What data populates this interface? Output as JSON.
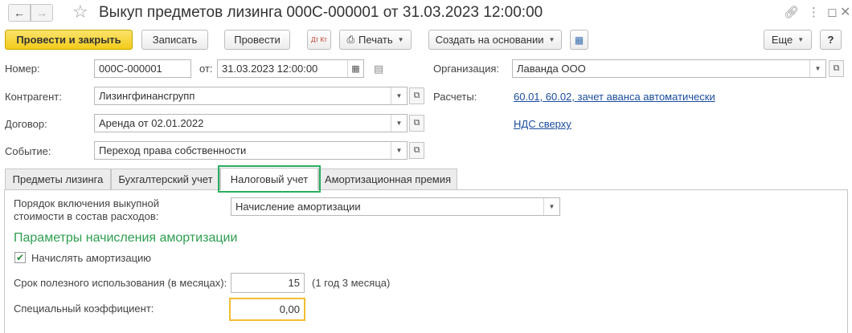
{
  "window": {
    "title": "Выкуп предметов лизинга 000С-000001 от 31.03.2023 12:00:00",
    "nav_back": "←",
    "nav_forward": "→",
    "star_icon": "☆"
  },
  "toolbar": {
    "post_close": "Провести и закрыть",
    "save": "Записать",
    "post": "Провести",
    "dt_kt": "Дт Кт",
    "print": "Печать",
    "create_based": "Создать на основании",
    "more": "Еще",
    "help": "?"
  },
  "form": {
    "number_label": "Номер:",
    "number_value": "000С-000001",
    "from_label": "от:",
    "date_value": "31.03.2023 12:00:00",
    "org_label": "Организация:",
    "org_value": "Лаванда ООО",
    "counterparty_label": "Контрагент:",
    "counterparty_value": "Лизингфинансгрупп",
    "settlements_label": "Расчеты:",
    "settlements_link": "60.01, 60.02, зачет аванса автоматически",
    "contract_label": "Договор:",
    "contract_value": "Аренда от 02.01.2022",
    "vat_link": "НДС сверху",
    "event_label": "Событие:",
    "event_value": "Переход права собственности"
  },
  "tabs": [
    {
      "label": "Предметы лизинга"
    },
    {
      "label": "Бухгалтерский учет"
    },
    {
      "label": "Налоговый учет"
    },
    {
      "label": "Амортизационная премия"
    }
  ],
  "tax": {
    "order_label_1": "Порядок включения выкупной",
    "order_label_2": "стоимости в состав расходов:",
    "order_value": "Начисление амортизации",
    "section_title": "Параметры начисления амортизации",
    "accrue_label": "Начислять амортизацию",
    "accrue_checked": true,
    "useful_life_label": "Срок полезного использования (в месяцах):",
    "useful_life_value": "15",
    "useful_life_hint": "(1 год 3 месяца)",
    "coef_label": "Специальный коэффициент:",
    "coef_value": "0,00"
  },
  "colors": {
    "primary_button": "#f3cc1a",
    "section_green": "#2d9e4f",
    "link_blue": "#1a4c9e",
    "focus_outline": "#f2bd35",
    "tab_highlight": "#27ae60"
  }
}
